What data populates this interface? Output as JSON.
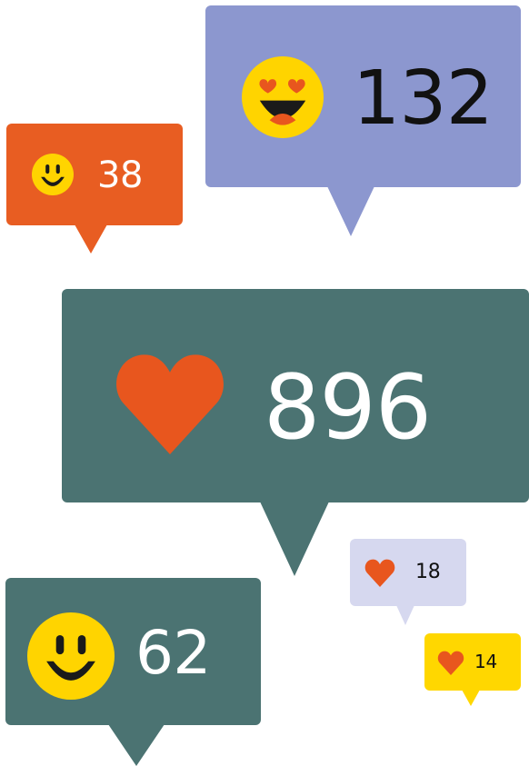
{
  "colors": {
    "purple": "#8c97cf",
    "orange": "#e85d22",
    "teal": "#4b7372",
    "lavender": "#d6d8ef",
    "yellow": "#ffd700",
    "emoji_yellow": "#ffd400",
    "heart_red": "#e8561e",
    "dark_text": "#111111",
    "white_text": "#ffffff"
  },
  "bubbles": [
    {
      "id": "purple-bubble",
      "icon": "heart-eyes-emoji-icon",
      "count": "132"
    },
    {
      "id": "orange-bubble",
      "icon": "smiley-emoji-icon",
      "count": "38"
    },
    {
      "id": "teal-large-bubble",
      "icon": "heart-icon",
      "count": "896"
    },
    {
      "id": "lavender-bubble",
      "icon": "heart-icon",
      "count": "18"
    },
    {
      "id": "yellow-bubble",
      "icon": "heart-icon",
      "count": "14"
    },
    {
      "id": "teal-small-bubble",
      "icon": "smiley-emoji-icon",
      "count": "62"
    }
  ]
}
